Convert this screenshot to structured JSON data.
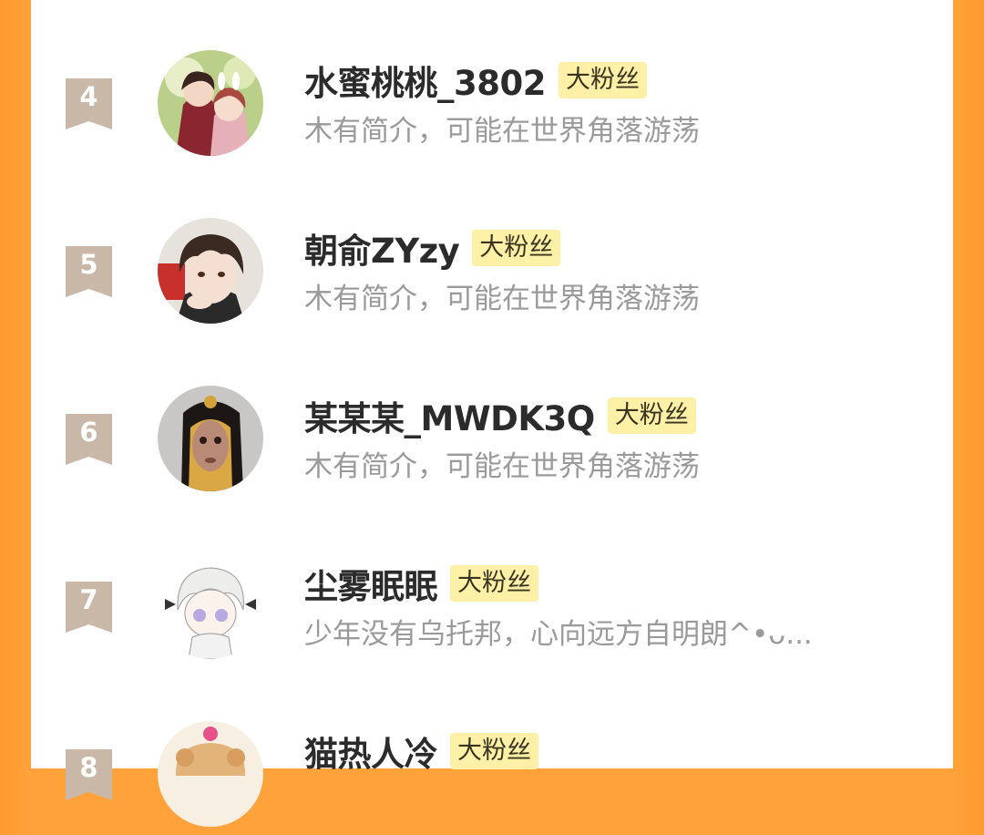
{
  "fans": [
    {
      "rank": "4",
      "name": "水蜜桃桃_3802",
      "badge": "大粉丝",
      "bio": "木有简介，可能在世界角落游荡",
      "avatar_icon": "anime-couple-avatar"
    },
    {
      "rank": "5",
      "name": "朝俞ZYzy",
      "badge": "大粉丝",
      "bio": "木有简介，可能在世界角落游荡",
      "avatar_icon": "anime-boy-avatar"
    },
    {
      "rank": "6",
      "name": "某某某_MWDK3Q",
      "badge": "大粉丝",
      "bio": "木有简介，可能在世界角落游荡",
      "avatar_icon": "doll-avatar"
    },
    {
      "rank": "7",
      "name": "尘雾眠眠",
      "badge": "大粉丝",
      "bio": "少年没有乌托邦，心向远方自明朗^•ᴗ...",
      "avatar_icon": "chibi-avatar"
    },
    {
      "rank": "8",
      "name": "猫热人冷",
      "badge": "大粉丝",
      "bio": "",
      "avatar_icon": "cupcake-avatar"
    }
  ],
  "colors": {
    "border_orange": "#ffa23a",
    "rank_ribbon": "#c9b8a8",
    "badge_bg": "#fff0a8",
    "name_text": "#2b2b2b",
    "bio_text": "#9a9a9a"
  }
}
